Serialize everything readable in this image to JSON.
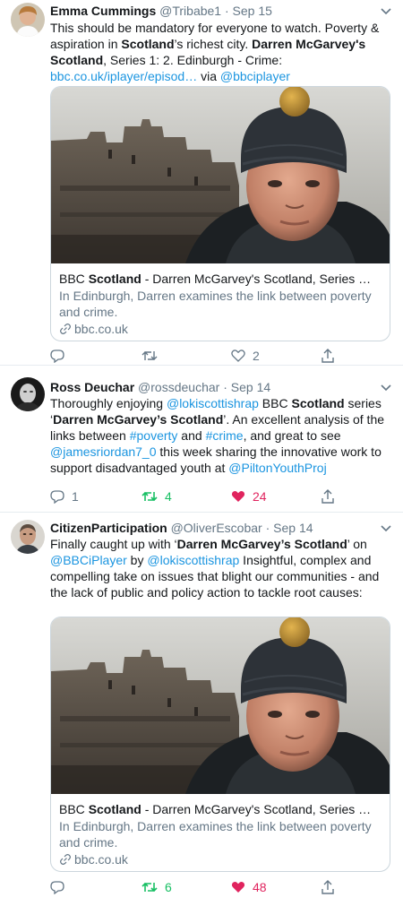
{
  "tweets": [
    {
      "name": "Emma Cummings",
      "handle": "@Tribabe1",
      "date": "Sep 15",
      "text_segments": [
        {
          "t": "This should be mandatory for everyone to watch. Poverty & aspiration in ",
          "s": "plain"
        },
        {
          "t": "Scotland",
          "s": "bold"
        },
        {
          "t": "’s richest city. ",
          "s": "plain"
        },
        {
          "t": "Darren McGarvey's Scotland",
          "s": "bold"
        },
        {
          "t": ", Series 1: 2. Edinburgh - Crime: ",
          "s": "plain"
        },
        {
          "t": "bbc.co.uk/iplayer/episod…",
          "s": "link"
        },
        {
          "t": " via ",
          "s": "plain"
        },
        {
          "t": "@bbciplayer",
          "s": "link"
        }
      ],
      "card": {
        "title_prefix": "BBC ",
        "title_bold": "Scotland",
        "title_suffix": " - Darren McGarvey's Scotland, Series …",
        "description": "In Edinburgh, Darren examines the link between poverty and crime.",
        "domain": "bbc.co.uk"
      },
      "actions": {
        "reply": "",
        "retweet": "",
        "like": "2"
      }
    },
    {
      "name": "Ross Deuchar",
      "handle": "@rossdeuchar",
      "date": "Sep 14",
      "text_segments": [
        {
          "t": "Thoroughly enjoying ",
          "s": "plain"
        },
        {
          "t": "@lokiscottishrap",
          "s": "link"
        },
        {
          "t": " BBC ",
          "s": "plain"
        },
        {
          "t": "Scotland",
          "s": "bold"
        },
        {
          "t": " series ‘",
          "s": "plain"
        },
        {
          "t": "Darren McGarvey’s Scotland",
          "s": "bold"
        },
        {
          "t": "’. An excellent analysis of the links between ",
          "s": "plain"
        },
        {
          "t": "#poverty",
          "s": "link"
        },
        {
          "t": " and ",
          "s": "plain"
        },
        {
          "t": "#crime",
          "s": "link"
        },
        {
          "t": ", and great to see ",
          "s": "plain"
        },
        {
          "t": "@jamesriordan7_0",
          "s": "link"
        },
        {
          "t": " this week sharing the innovative work to support disadvantaged youth at ",
          "s": "plain"
        },
        {
          "t": "@PiltonYouthProj",
          "s": "link"
        }
      ],
      "actions": {
        "reply": "1",
        "retweet": "4",
        "like": "24"
      }
    },
    {
      "name": "CitizenParticipation",
      "handle": "@OliverEscobar",
      "date": "Sep 14",
      "text_segments": [
        {
          "t": "Finally caught up with ‘",
          "s": "plain"
        },
        {
          "t": "Darren McGarvey’s Scotland",
          "s": "bold"
        },
        {
          "t": "’ on ",
          "s": "plain"
        },
        {
          "t": "@BBCiPlayer",
          "s": "link"
        },
        {
          "t": " by ",
          "s": "plain"
        },
        {
          "t": "@lokiscottishrap",
          "s": "link"
        },
        {
          "t": " Insightful, complex and compelling take on issues that blight our communities - and the lack of public and policy action to tackle root causes:",
          "s": "plain"
        }
      ],
      "card": {
        "title_prefix": "BBC ",
        "title_bold": "Scotland",
        "title_suffix": " - Darren McGarvey's Scotland, Series …",
        "description": "In Edinburgh, Darren examines the link between poverty and crime.",
        "domain": "bbc.co.uk"
      },
      "actions": {
        "reply": "",
        "retweet": "6",
        "like": "48"
      }
    }
  ],
  "colors": {
    "link": "#1b95e0",
    "secondary": "#657786",
    "retweet_active": "#17bf63",
    "like_active": "#e0245e",
    "divider": "#e6ecf0"
  }
}
